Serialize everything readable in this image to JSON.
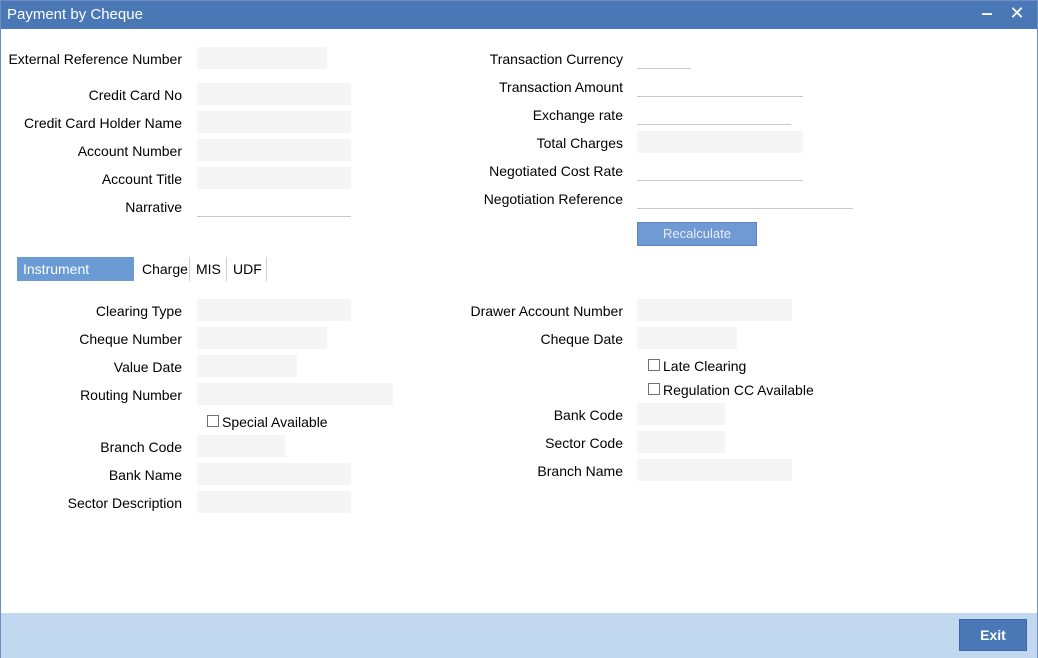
{
  "window": {
    "title": "Payment by Cheque",
    "minimize_icon": "‒",
    "close_icon": "✕"
  },
  "header_left": {
    "external_reference_number": {
      "label": "External Reference Number",
      "value": ""
    },
    "credit_card_no": {
      "label": "Credit Card No",
      "value": ""
    },
    "credit_card_holder_name": {
      "label": "Credit Card Holder Name",
      "value": ""
    },
    "account_number": {
      "label": "Account Number",
      "value": ""
    },
    "account_title": {
      "label": "Account Title",
      "value": ""
    },
    "narrative": {
      "label": "Narrative",
      "value": ""
    }
  },
  "header_right": {
    "transaction_currency": {
      "label": "Transaction Currency",
      "value": ""
    },
    "transaction_amount": {
      "label": "Transaction Amount",
      "value": ""
    },
    "exchange_rate": {
      "label": "Exchange rate",
      "value": ""
    },
    "total_charges": {
      "label": "Total Charges",
      "value": ""
    },
    "negotiated_cost_rate": {
      "label": "Negotiated Cost Rate",
      "value": ""
    },
    "negotiation_reference": {
      "label": "Negotiation Reference",
      "value": ""
    },
    "recalculate_label": "Recalculate"
  },
  "tabs": [
    {
      "label": "Instrument Details",
      "active": true
    },
    {
      "label": "Charge",
      "active": false
    },
    {
      "label": "MIS",
      "active": false
    },
    {
      "label": "UDF",
      "active": false
    }
  ],
  "instrument_left": {
    "clearing_type": {
      "label": "Clearing Type",
      "value": ""
    },
    "cheque_number": {
      "label": "Cheque Number",
      "value": ""
    },
    "value_date": {
      "label": "Value Date",
      "value": ""
    },
    "routing_number": {
      "label": "Routing Number",
      "value": ""
    },
    "special_available": {
      "label": "Special Available",
      "checked": false
    },
    "branch_code": {
      "label": "Branch Code",
      "value": ""
    },
    "bank_name": {
      "label": "Bank Name",
      "value": ""
    },
    "sector_description": {
      "label": "Sector Description",
      "value": ""
    }
  },
  "instrument_right": {
    "drawer_account_number": {
      "label": "Drawer Account Number",
      "value": ""
    },
    "cheque_date": {
      "label": "Cheque Date",
      "value": ""
    },
    "late_clearing": {
      "label": "Late Clearing",
      "checked": false
    },
    "regulation_cc_available": {
      "label": "Regulation CC Available",
      "checked": false
    },
    "bank_code": {
      "label": "Bank Code",
      "value": ""
    },
    "sector_code": {
      "label": "Sector Code",
      "value": ""
    },
    "branch_name": {
      "label": "Branch Name",
      "value": ""
    }
  },
  "footer": {
    "exit_label": "Exit"
  },
  "colors": {
    "titlebar": "#4a78b6",
    "active_tab": "#6a9bd5",
    "recalculate_button": "#6f9ad3",
    "footer": "#c2d8ee",
    "exit_button": "#4a78b6"
  }
}
